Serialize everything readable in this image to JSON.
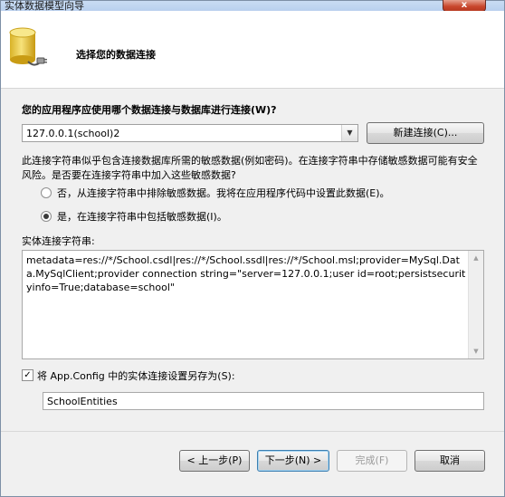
{
  "window": {
    "title": "实体数据模型向导",
    "close_label": "x"
  },
  "header": {
    "title": "选择您的数据连接",
    "icon": "database-plug-icon"
  },
  "connection": {
    "question": "您的应用程序应使用哪个数据连接与数据库进行连接(W)?",
    "selected": "127.0.0.1(school)2",
    "new_button": "新建连接(C)..."
  },
  "warning": {
    "text": "此连接字符串似乎包含连接数据库所需的敏感数据(例如密码)。在连接字符串中存储敏感数据可能有安全风险。是否要在连接字符串中加入这些敏感数据?",
    "option_no": "否，从连接字符串中排除敏感数据。我将在应用程序代码中设置此数据(E)。",
    "option_yes": "是，在连接字符串中包括敏感数据(I)。",
    "selected": "yes"
  },
  "entity_string": {
    "label": "实体连接字符串:",
    "value": "metadata=res://*/School.csdl|res://*/School.ssdl|res://*/School.msl;provider=MySql.Data.MySqlClient;provider connection string=\"server=127.0.0.1;user id=root;persistsecurityinfo=True;database=school\""
  },
  "save": {
    "checked": true,
    "label": "将 App.Config 中的实体连接设置另存为(S):",
    "value": "SchoolEntities"
  },
  "footer": {
    "prev": "< 上一步(P)",
    "next": "下一步(N) >",
    "finish": "完成(F)",
    "cancel": "取消"
  },
  "colors": {
    "close_button": "#c8462c",
    "default_button_border": "#3c7fb1"
  }
}
